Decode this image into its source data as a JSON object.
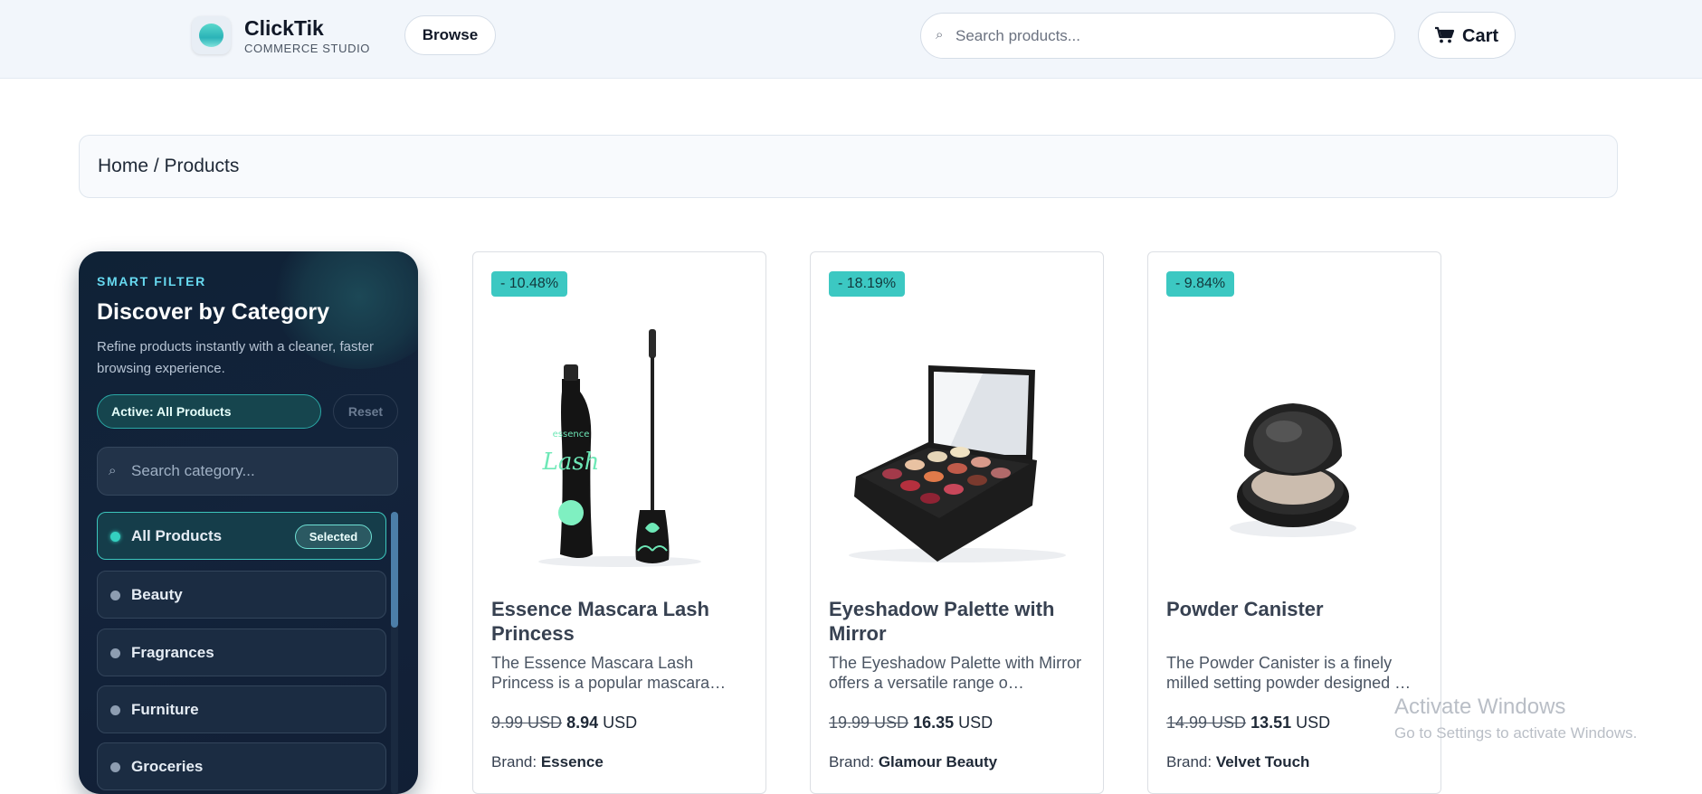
{
  "header": {
    "brand_name": "ClickTik",
    "brand_sub": "COMMERCE STUDIO",
    "browse_label": "Browse",
    "search_placeholder": "Search products...",
    "cart_label": "Cart",
    "icons": {
      "logo": "logo-orb-icon",
      "search": "search-icon",
      "cart": "cart-icon"
    }
  },
  "breadcrumb": {
    "text": "Home / Products"
  },
  "sidebar": {
    "kicker": "SMART FILTER",
    "title": "Discover by Category",
    "description": "Refine products instantly with a cleaner, faster browsing experience.",
    "active_label": "Active: All Products",
    "reset_label": "Reset",
    "search_placeholder": "Search category...",
    "selected_badge": "Selected",
    "categories": [
      {
        "label": "All Products"
      },
      {
        "label": "Beauty"
      },
      {
        "label": "Fragrances"
      },
      {
        "label": "Furniture"
      },
      {
        "label": "Groceries"
      }
    ],
    "scroll_position": 0.0
  },
  "products": [
    {
      "discount": "- 10.48%",
      "title": "Essence Mascara Lash Princess",
      "description": "The Essence Mascara Lash Princess is a popular mascara…",
      "old_price": "9.99 USD",
      "new_price": "8.94",
      "currency": "USD",
      "brand_label": "Brand:",
      "brand": "Essence",
      "image_icon": "mascara-icon"
    },
    {
      "discount": "- 18.19%",
      "title": "Eyeshadow Palette with Mirror",
      "description": "The Eyeshadow Palette with Mirror offers a versatile range o…",
      "old_price": "19.99 USD",
      "new_price": "16.35",
      "currency": "USD",
      "brand_label": "Brand:",
      "brand": "Glamour Beauty",
      "image_icon": "eyeshadow-palette-icon"
    },
    {
      "discount": "- 9.84%",
      "title": "Powder Canister",
      "description": "The Powder Canister is a finely milled setting powder designed …",
      "old_price": "14.99 USD",
      "new_price": "13.51",
      "currency": "USD",
      "brand_label": "Brand:",
      "brand": "Velvet Touch",
      "image_icon": "powder-compact-icon"
    }
  ],
  "watermark": {
    "line1": "Activate Windows",
    "line2": "Go to Settings to activate Windows."
  },
  "colors": {
    "accent": "#3cc8c2",
    "sidebar_bg": "#13233b",
    "kicker": "#67d9f0"
  }
}
